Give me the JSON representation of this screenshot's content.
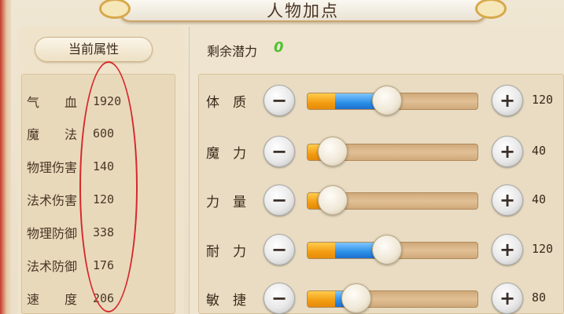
{
  "title": "人物加点",
  "left": {
    "header": "当前属性",
    "stats": [
      {
        "label": "气　　血",
        "value": "1920"
      },
      {
        "label": "魔　　法",
        "value": "600"
      },
      {
        "label": "物理伤害",
        "value": "140"
      },
      {
        "label": "法术伤害",
        "value": "120"
      },
      {
        "label": "物理防御",
        "value": "338"
      },
      {
        "label": "法术防御",
        "value": "176"
      },
      {
        "label": "速　　度",
        "value": "206"
      }
    ]
  },
  "right": {
    "potential_label": "剩余潜力",
    "potential_value": "0",
    "attributes": [
      {
        "label": "体　质",
        "value": "120",
        "orange_fraction": 0.16,
        "blue_fraction": 0.28
      },
      {
        "label": "魔　力",
        "value": "40",
        "orange_fraction": 0.07,
        "blue_fraction": 0
      },
      {
        "label": "力　量",
        "value": "40",
        "orange_fraction": 0.07,
        "blue_fraction": 0
      },
      {
        "label": "耐　力",
        "value": "120",
        "orange_fraction": 0.16,
        "blue_fraction": 0.28
      },
      {
        "label": "敏　捷",
        "value": "80",
        "orange_fraction": 0.16,
        "blue_fraction": 0.1
      }
    ],
    "minus_symbol": "−",
    "plus_symbol": "+"
  },
  "colors": {
    "highlight_oval": "#d6282a",
    "potential_value": "#4fc233",
    "bar_orange": "#f39c12",
    "bar_blue": "#2b8fe6"
  }
}
